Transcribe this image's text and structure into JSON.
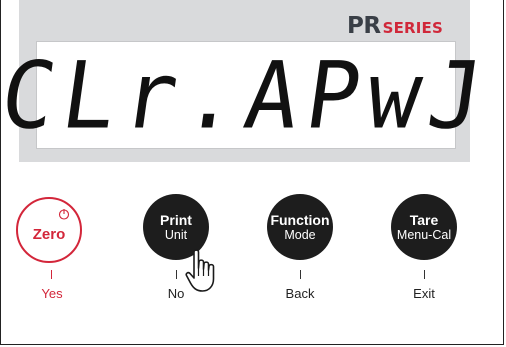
{
  "brand": {
    "prefix": "PR",
    "suffix": "SERIES"
  },
  "display": {
    "text": "CLr.APwJ"
  },
  "keys": [
    {
      "label": "Zero",
      "sub": "",
      "alt": "Yes"
    },
    {
      "label": "Print",
      "sub": "Unit",
      "alt": "No"
    },
    {
      "label": "Function",
      "sub": "Mode",
      "alt": "Back"
    },
    {
      "label": "Tare",
      "sub": "Menu-Cal",
      "alt": "Exit"
    }
  ],
  "icons": {
    "power": "power-icon",
    "cursor": "hand-pointer-icon"
  },
  "colors": {
    "accent": "#d3263a",
    "key": "#1d1d1d",
    "panel": "#d9dadc",
    "brand_text": "#3a3f47"
  }
}
